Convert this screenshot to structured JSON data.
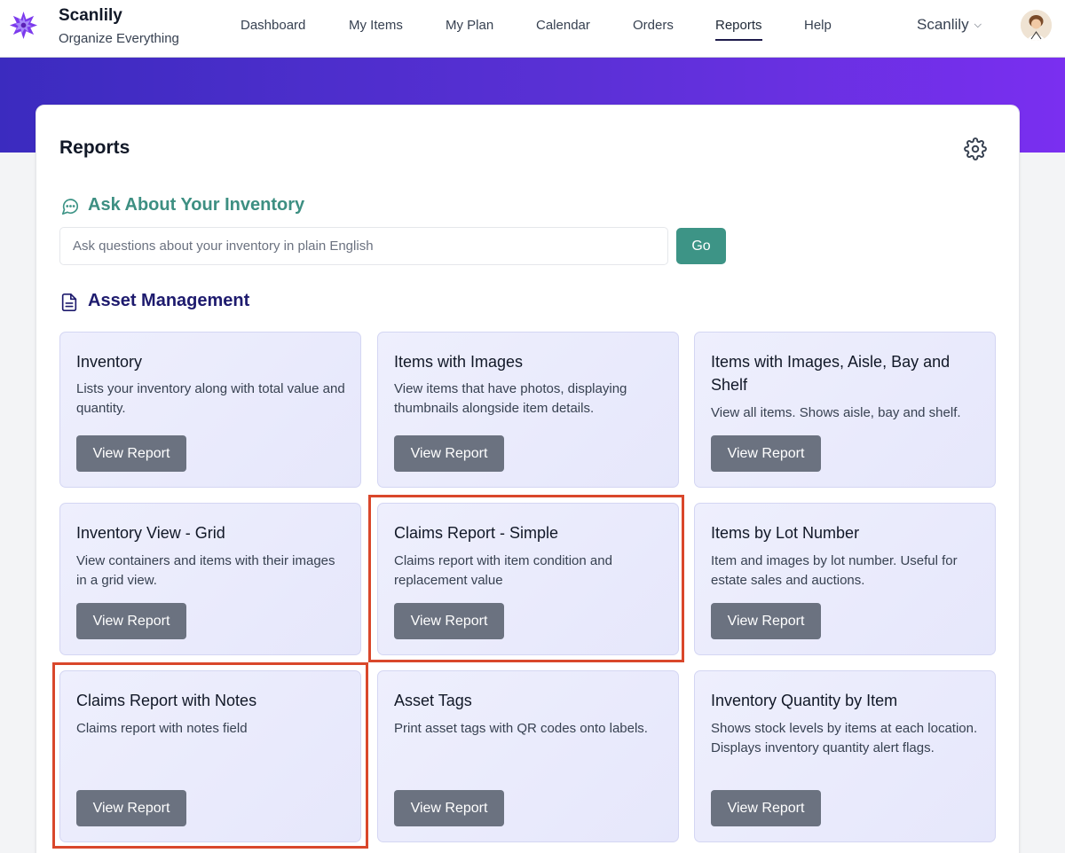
{
  "app": {
    "name": "Scanlily",
    "tagline": "Organize Everything"
  },
  "nav": {
    "items": [
      {
        "label": "Dashboard"
      },
      {
        "label": "My Items"
      },
      {
        "label": "My Plan"
      },
      {
        "label": "Calendar"
      },
      {
        "label": "Orders"
      },
      {
        "label": "Reports",
        "active": true
      },
      {
        "label": "Help"
      }
    ],
    "account_label": "Scanlily"
  },
  "page": {
    "title": "Reports"
  },
  "ask": {
    "title": "Ask About Your Inventory",
    "placeholder": "Ask questions about your inventory in plain English",
    "value": "",
    "go_label": "Go"
  },
  "section": {
    "title": "Asset Management"
  },
  "cards": [
    {
      "title": "Inventory",
      "description": "Lists your inventory along with total value and quantity.",
      "button": "View Report"
    },
    {
      "title": "Items with Images",
      "description": "View items that have photos, displaying thumbnails alongside item details.",
      "button": "View Report"
    },
    {
      "title": "Items with Images, Aisle, Bay and Shelf",
      "description": "View all items. Shows aisle, bay and shelf.",
      "button": "View Report"
    },
    {
      "title": "Inventory View - Grid",
      "description": "View containers and items with their images in a grid view.",
      "button": "View Report"
    },
    {
      "title": "Claims Report - Simple",
      "description": "Claims report with item condition and replacement value",
      "button": "View Report",
      "highlighted": true
    },
    {
      "title": "Items by Lot Number",
      "description": "Item and images by lot number. Useful for estate sales and auctions.",
      "button": "View Report"
    },
    {
      "title": "Claims Report with Notes",
      "description": "Claims report with notes field",
      "button": "View Report",
      "highlighted": true
    },
    {
      "title": "Asset Tags",
      "description": "Print asset tags with QR codes onto labels.",
      "button": "View Report"
    },
    {
      "title": "Inventory Quantity by Item",
      "description": "Shows stock levels by items at each location. Displays inventory quantity alert flags.",
      "button": "View Report"
    }
  ],
  "colors": {
    "accent_teal": "#3d9486",
    "section_navy": "#1e1b6e",
    "highlight_red": "#d9472b",
    "button_gray": "#6b7280",
    "band_start": "#3b2bbf",
    "band_end": "#7a2ff0"
  },
  "icons": {
    "logo": "purple-star-logo-icon",
    "account": "chevron-down-icon",
    "settings": "gear-icon",
    "ask": "chat-bubble-icon",
    "section": "document-icon"
  }
}
